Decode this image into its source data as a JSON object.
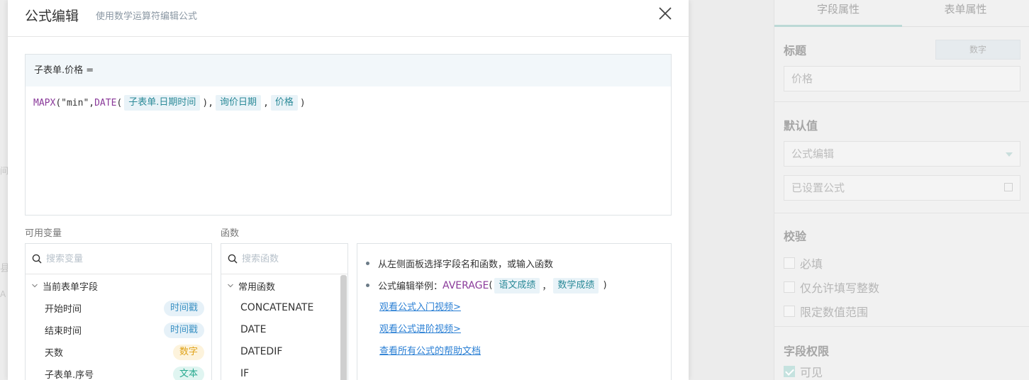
{
  "background": {
    "fragments": [
      "间",
      "县",
      "A"
    ]
  },
  "right_panel": {
    "tabs": [
      "字段属性",
      "表单属性"
    ],
    "title_label": "标题",
    "type_badge": "数字",
    "title_value": "价格",
    "default_label": "默认值",
    "default_mode": "公式编辑",
    "formula_status": "已设置公式",
    "validate_label": "校验",
    "checks": [
      "必填",
      "仅允许填写整数",
      "限定数值范围"
    ],
    "perm_label": "字段权限",
    "visible_label": "可见"
  },
  "modal": {
    "title": "公式编辑",
    "subtitle": "使用数学运算符编辑公式",
    "editor": {
      "header": "子表单.价格 =",
      "tokens": {
        "t1": "MAPX",
        "t2": "(\"min\",",
        "t3": "DATE",
        "t4": "(",
        "chip1": "子表单.日期时间",
        "t5": "),",
        "chip2": "询价日期",
        "t6": ",",
        "chip3": "价格",
        "t7": ")"
      }
    },
    "variables": {
      "label": "可用变量",
      "search_placeholder": "搜索变量",
      "group": "当前表单字段",
      "items": [
        {
          "name": "开始时间",
          "type": "时间戳"
        },
        {
          "name": "结束时间",
          "type": "时间戳"
        },
        {
          "name": "天数",
          "type": "数字"
        },
        {
          "name": "子表单.序号",
          "type": "文本"
        }
      ]
    },
    "functions": {
      "label": "函数",
      "search_placeholder": "搜索函数",
      "group": "常用函数",
      "items": [
        "CONCATENATE",
        "DATE",
        "DATEDIF",
        "IF"
      ]
    },
    "help": {
      "tip1": "从左侧面板选择字段名和函数，或输入函数",
      "tip2_prefix": "公式编辑举例：",
      "tip2_fn": "AVERAGE",
      "tip2_open": "(",
      "tip2_chip1": "语文成绩",
      "tip2_comma": "，",
      "tip2_chip2": "数学成绩",
      "tip2_close": ")",
      "links": [
        "观看公式入门视频>",
        "观看公式进阶视频>",
        "查看所有公式的帮助文档"
      ]
    }
  }
}
